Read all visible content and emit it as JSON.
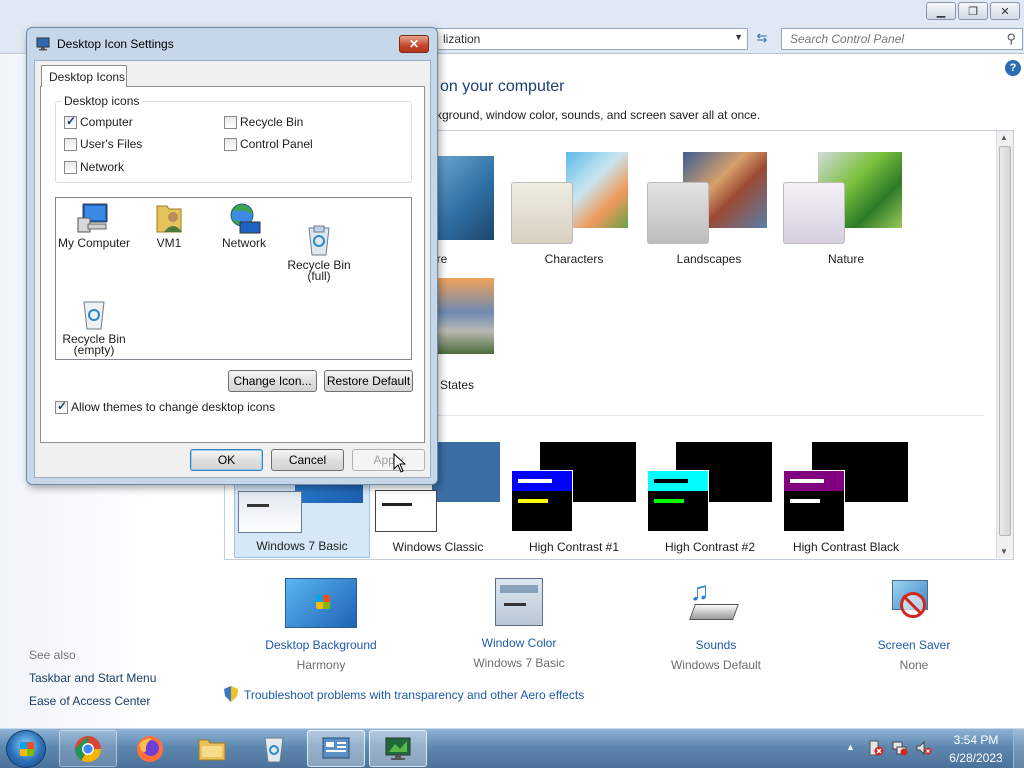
{
  "control_panel": {
    "address_text": "lization",
    "search_placeholder": "Search Control Panel",
    "heading": "on your computer",
    "subheading": "kground, window color, sounds, and screen saver all at once.",
    "themes_row1": [
      "ecture",
      "Characters",
      "Landscapes",
      "Nature"
    ],
    "themes_row2": [
      "States"
    ],
    "basic_themes": [
      "Windows 7 Basic",
      "Windows Classic",
      "High Contrast #1",
      "High Contrast #2",
      "High Contrast Black"
    ],
    "bottom_items": [
      {
        "name": "Desktop Background",
        "value": "Harmony"
      },
      {
        "name": "Window Color",
        "value": "Windows 7 Basic"
      },
      {
        "name": "Sounds",
        "value": "Windows Default"
      },
      {
        "name": "Screen Saver",
        "value": "None"
      }
    ],
    "troubleshoot": "Troubleshoot problems with transparency and other Aero effects",
    "see_also": {
      "header": "See also",
      "links": [
        "Taskbar and Start Menu",
        "Ease of Access Center"
      ]
    },
    "help_glyph": "?"
  },
  "dialog": {
    "title": "Desktop Icon Settings",
    "close_glyph": "✕",
    "tab": "Desktop Icons",
    "group_label": "Desktop icons",
    "checkboxes": [
      {
        "label": "Computer",
        "checked": true
      },
      {
        "label": "Recycle Bin",
        "checked": false
      },
      {
        "label": "User's Files",
        "checked": false
      },
      {
        "label": "Control Panel",
        "checked": false
      },
      {
        "label": "Network",
        "checked": false
      }
    ],
    "icons": [
      {
        "label": "My Computer",
        "icon": "computer-icon"
      },
      {
        "label": "VM1",
        "icon": "user-folder-icon"
      },
      {
        "label": "Network",
        "icon": "network-icon"
      },
      {
        "label": "Recycle Bin\n(full)",
        "icon": "recycle-bin-full-icon"
      },
      {
        "label": "Recycle Bin\n(empty)",
        "icon": "recycle-bin-empty-icon"
      }
    ],
    "change_icon": "Change Icon...",
    "restore_default": "Restore Default",
    "allow_themes": {
      "label": "Allow themes to change desktop icons",
      "checked": true
    },
    "ok": "OK",
    "cancel": "Cancel",
    "apply": "Apply"
  },
  "taskbar": {
    "apps": [
      "chrome-icon",
      "firefox-icon",
      "file-explorer-icon",
      "recycle-bin-icon",
      "control-panel-icon",
      "desktop-icon-settings-icon"
    ],
    "time": "3:54 PM",
    "date": "6/28/2023"
  },
  "colors": {
    "link": "#1f5aa8",
    "heading": "#1e3f73",
    "hc1_bar": "#0000ff",
    "hc2_bar": "#00ffff",
    "hcblack_bar": "#800080"
  }
}
